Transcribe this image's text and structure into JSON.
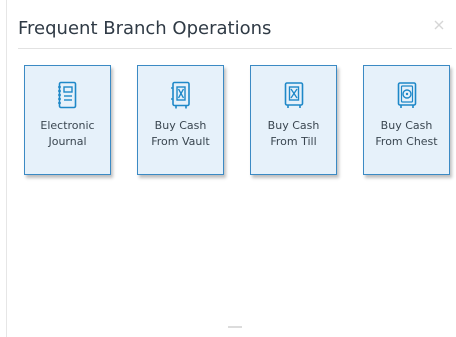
{
  "panel": {
    "title": "Frequent Branch Operations",
    "close_label": "×"
  },
  "tiles": [
    {
      "label": "Electronic Journal",
      "icon": "journal-icon"
    },
    {
      "label": "Buy Cash From Vault",
      "icon": "vault-icon"
    },
    {
      "label": "Buy Cash From Till",
      "icon": "till-icon"
    },
    {
      "label": "Buy Cash From Chest",
      "icon": "chest-icon"
    }
  ],
  "colors": {
    "tile_border": "#3b8ac4",
    "tile_background": "#e6f1fa",
    "icon": "#1e88c8",
    "title_text": "#2f3a45"
  }
}
